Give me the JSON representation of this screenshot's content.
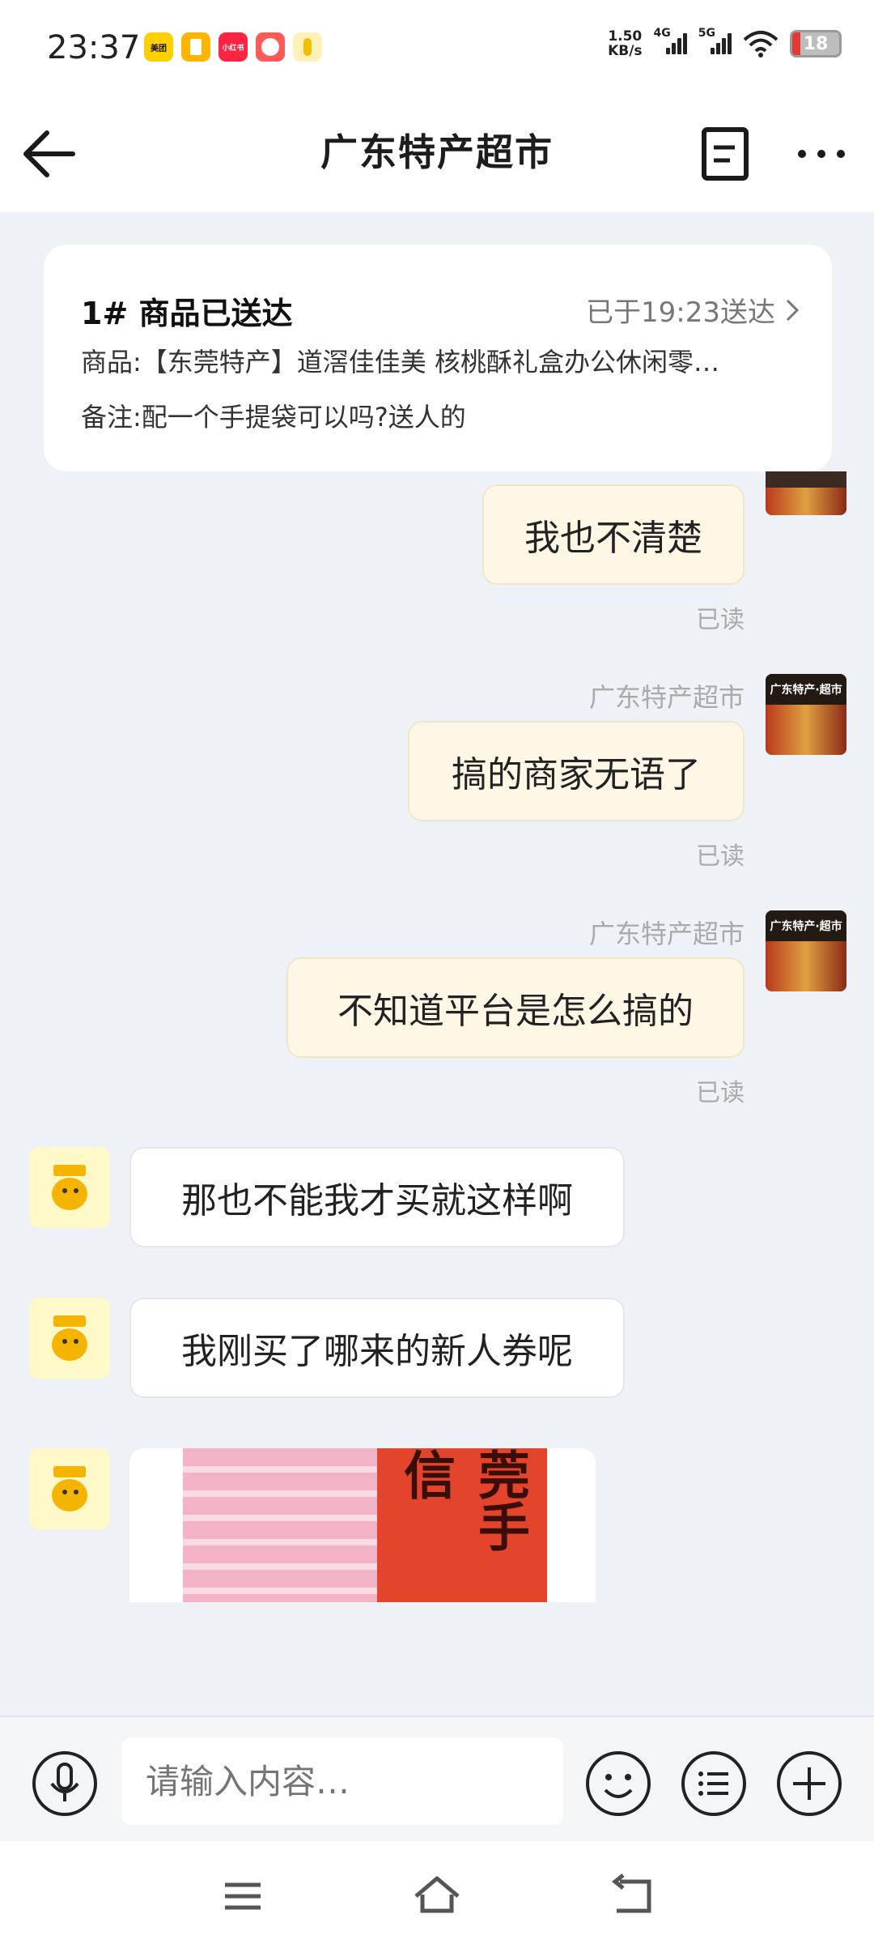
{
  "status": {
    "time": "23:37",
    "app_icons": [
      {
        "name": "美团",
        "color": "#ffd000"
      },
      {
        "name": "",
        "color": "#ffb400"
      },
      {
        "name": "小红书",
        "color": "#ff2442"
      },
      {
        "name": "",
        "color": "#ff5a5a"
      },
      {
        "name": "",
        "color": "#fff1b8"
      }
    ],
    "speed_value": "1.50",
    "speed_unit": "KB/s",
    "net1": "4G",
    "net2": "5G",
    "battery": "18"
  },
  "header": {
    "title": "广东特产超市"
  },
  "order": {
    "title": "1# 商品已送达",
    "status": "已于19:23送达",
    "product": "商品:【东莞特产】道滘佳佳美 核桃酥礼盒办公休闲零…",
    "note": "备注:配一个手提袋可以吗?送人的"
  },
  "messages": {
    "m1": {
      "text": "我也不清楚",
      "read": "已读"
    },
    "m2": {
      "sender": "广东特产超市",
      "text": "搞的商家无语了",
      "read": "已读"
    },
    "m3": {
      "sender": "广东特产超市",
      "text": "不知道平台是怎么搞的",
      "read": "已读"
    },
    "m4": {
      "text": "那也不能我才买就这样啊"
    },
    "m5": {
      "text": "我刚买了哪来的新人券呢"
    },
    "m6": {
      "image_caption": "莞手信"
    }
  },
  "shop_avatar_text": "广东特产·超市",
  "input": {
    "placeholder": "请输入内容…"
  },
  "colors": {
    "outgoing_bubble": "#fff7e6",
    "incoming_bubble": "#ffffff",
    "background": "#eef1f5"
  }
}
